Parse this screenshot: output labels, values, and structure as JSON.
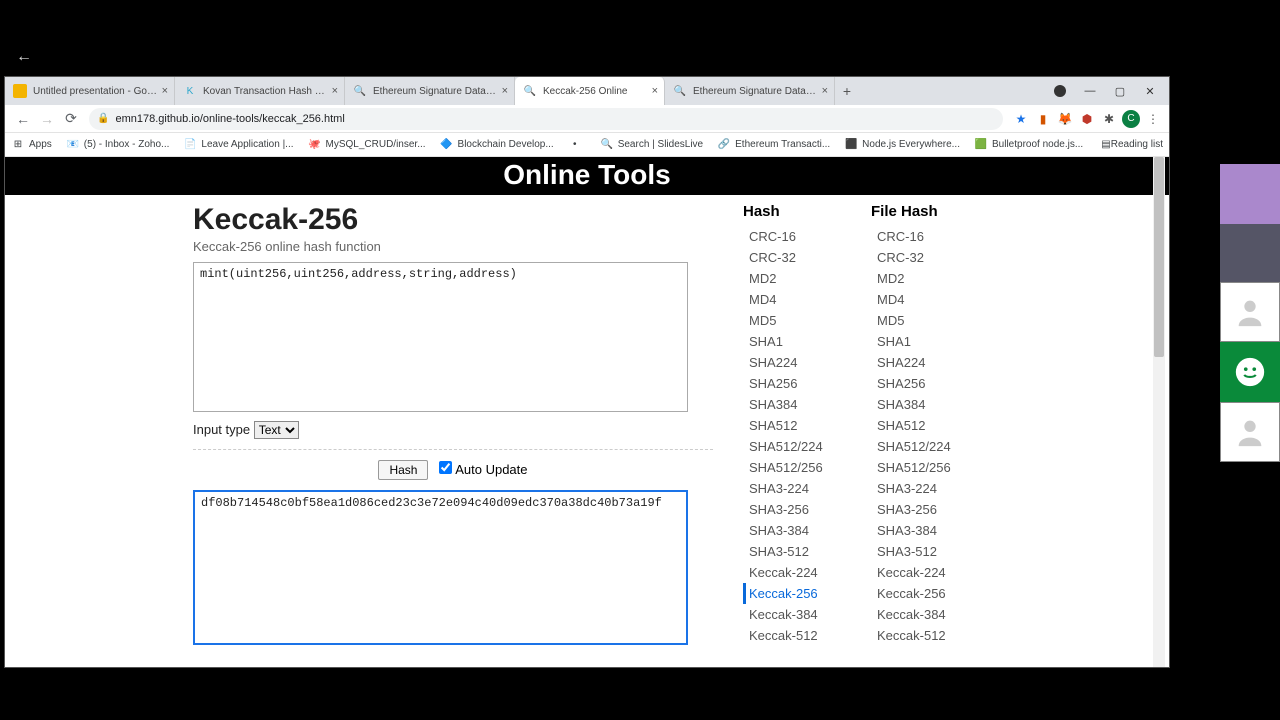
{
  "tabs": [
    {
      "title": "Untitled presentation - Google S",
      "favicon_color": "#f4b400"
    },
    {
      "title": "Kovan Transaction Hash (Txhash)",
      "favicon_text": "K",
      "favicon_color": "#2fa8cc"
    },
    {
      "title": "Ethereum Signature Database",
      "favicon_text": "🔍"
    },
    {
      "title": "Keccak-256 Online",
      "favicon_text": "🔍",
      "active": true
    },
    {
      "title": "Ethereum Signature Database",
      "favicon_text": "🔍"
    }
  ],
  "url": "emn178.github.io/online-tools/keccak_256.html",
  "bookmarks": [
    {
      "label": "Apps"
    },
    {
      "label": "(5) - Inbox - Zoho..."
    },
    {
      "label": "Leave Application |..."
    },
    {
      "label": "MySQL_CRUD/inser..."
    },
    {
      "label": "Blockchain Develop..."
    },
    {
      "label": ""
    },
    {
      "label": "Search | SlidesLive"
    },
    {
      "label": "Ethereum Transacti..."
    },
    {
      "label": "Node.js Everywhere..."
    },
    {
      "label": "Bulletproof node.js..."
    }
  ],
  "reading_list": "Reading list",
  "page": {
    "header": "Online Tools",
    "title": "Keccak-256",
    "subtitle": "Keccak-256 online hash function",
    "input_value": "mint(uint256,uint256,address,string,address)",
    "input_type_label": "Input type",
    "input_type_value": "Text",
    "hash_button": "Hash",
    "auto_update_label": "Auto Update",
    "auto_update_checked": true,
    "output_value": "df08b714548c0bf58ea1d086ced23c3e72e094c40d09edc370a38dc40b73a19f"
  },
  "hash_list_title": "Hash",
  "file_hash_list_title": "File Hash",
  "hash_list": [
    "CRC-16",
    "CRC-32",
    "MD2",
    "MD4",
    "MD5",
    "SHA1",
    "SHA224",
    "SHA256",
    "SHA384",
    "SHA512",
    "SHA512/224",
    "SHA512/256",
    "SHA3-224",
    "SHA3-256",
    "SHA3-384",
    "SHA3-512",
    "Keccak-224",
    "Keccak-256",
    "Keccak-384",
    "Keccak-512"
  ],
  "file_hash_list": [
    "CRC-16",
    "CRC-32",
    "MD2",
    "MD4",
    "MD5",
    "SHA1",
    "SHA224",
    "SHA256",
    "SHA384",
    "SHA512",
    "SHA512/224",
    "SHA512/256",
    "SHA3-224",
    "SHA3-256",
    "SHA3-384",
    "SHA3-512",
    "Keccak-224",
    "Keccak-256",
    "Keccak-384",
    "Keccak-512"
  ],
  "active_hash": "Keccak-256"
}
